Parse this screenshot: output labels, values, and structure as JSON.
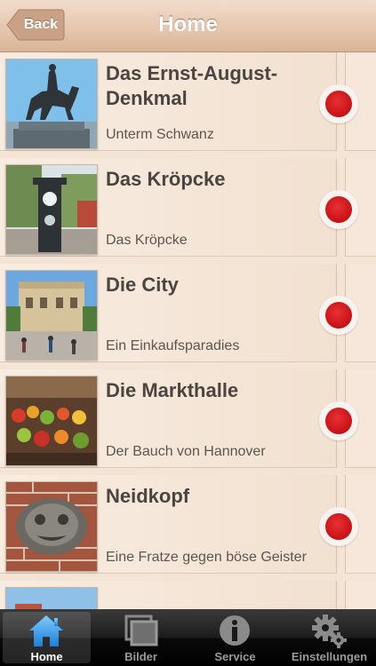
{
  "nav": {
    "back_label": "Back",
    "title": "Home"
  },
  "rows": [
    {
      "title": "Das Ernst-August-Denkmal",
      "subtitle": "Unterm Schwanz"
    },
    {
      "title": "Das Kröpcke",
      "subtitle": "Das Kröpcke"
    },
    {
      "title": "Die City",
      "subtitle": "Ein Einkaufsparadies"
    },
    {
      "title": "Die Markthalle",
      "subtitle": "Der Bauch von Hannover"
    },
    {
      "title": "Neidkopf",
      "subtitle": "Eine Fratze gegen böse Geister"
    }
  ],
  "tabs": [
    {
      "label": "Home",
      "icon": "home-icon",
      "active": true
    },
    {
      "label": "Bilder",
      "icon": "pictures-icon"
    },
    {
      "label": "Service",
      "icon": "info-icon"
    },
    {
      "label": "Einstellungen",
      "icon": "settings-icon"
    }
  ],
  "colors": {
    "accent_dot": "#cd1518",
    "nav_bg": "#e6c7ae",
    "row_bg": "#f5e6d7",
    "tab_active": "#ffffff"
  }
}
